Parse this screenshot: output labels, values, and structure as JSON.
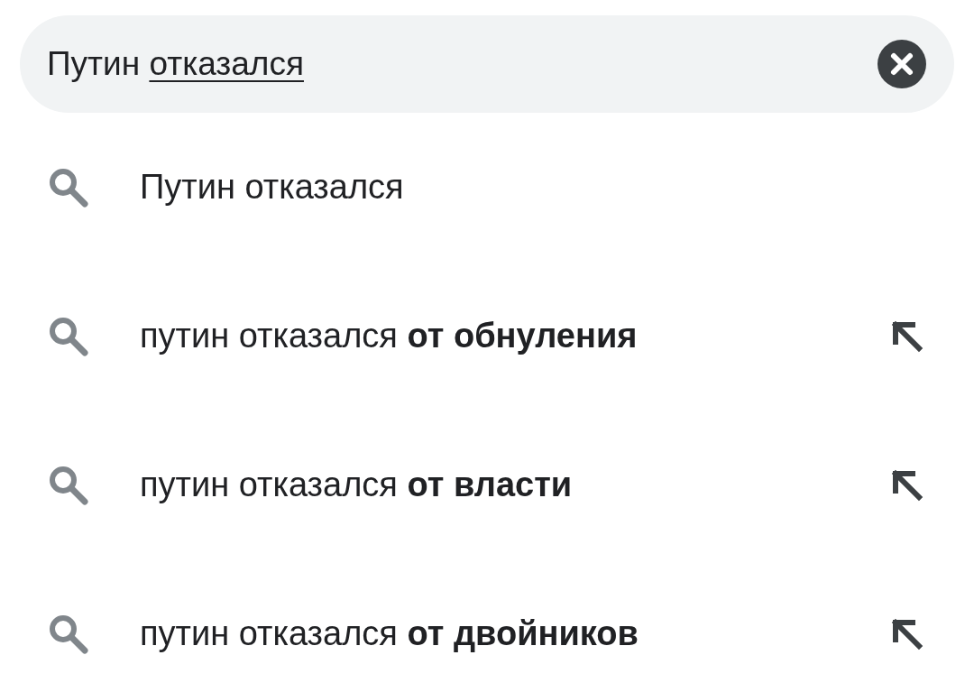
{
  "search": {
    "query_parts": [
      {
        "text": "Путин ",
        "underlined": false
      },
      {
        "text": "отказался",
        "underlined": true
      }
    ]
  },
  "suggestions": [
    {
      "text": "Путин отказался",
      "fill_arrow": false
    },
    {
      "text": "путин отказался **от обнуления**",
      "fill_arrow": true
    },
    {
      "text": "путин отказался **от власти**",
      "fill_arrow": true
    },
    {
      "text": "путин отказался **от двойников**",
      "fill_arrow": true
    }
  ]
}
